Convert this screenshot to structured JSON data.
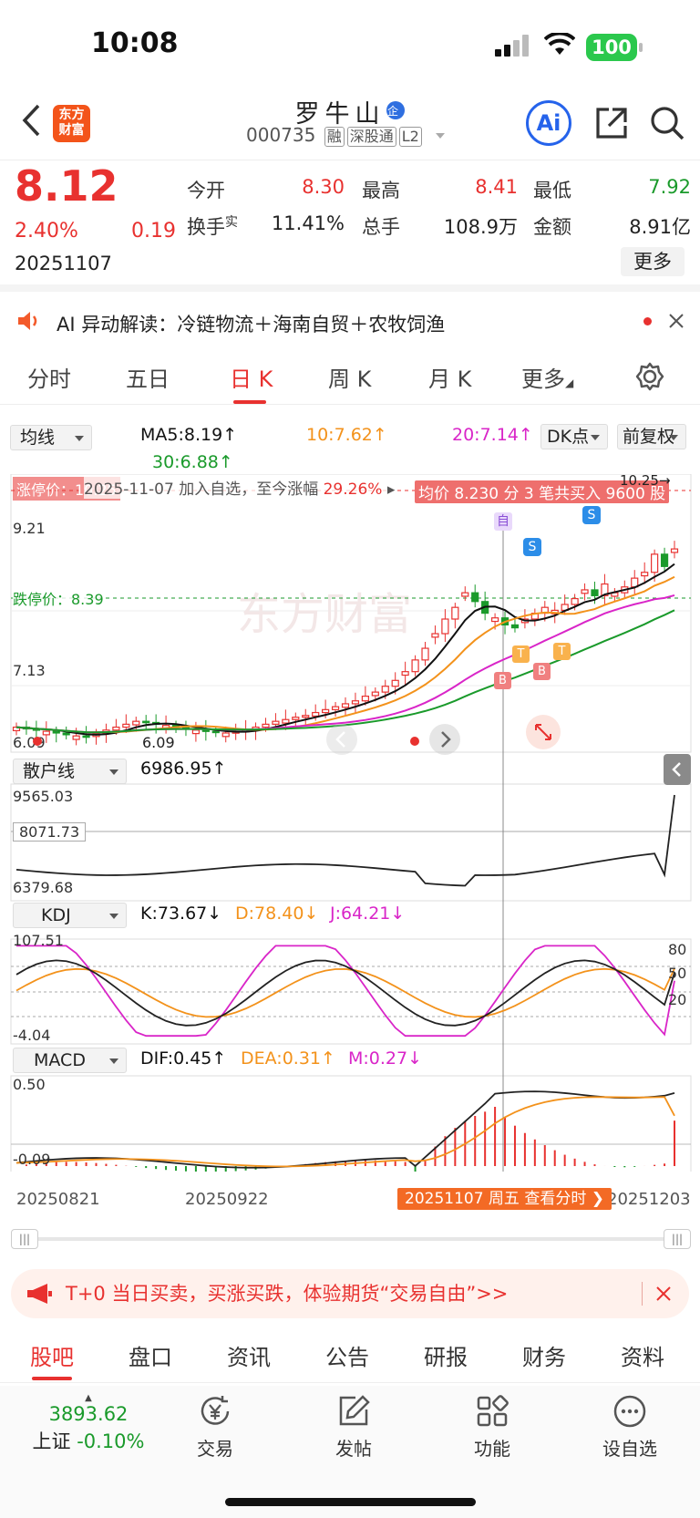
{
  "status": {
    "time": "10:08",
    "battery": "100"
  },
  "header": {
    "name": "罗牛山",
    "code": "000735",
    "tags": [
      "融",
      "深股通",
      "L2"
    ],
    "logo": "东方\n财富",
    "ai_label": "Ai"
  },
  "quote": {
    "price": "8.12",
    "change_pct": "2.40%",
    "change": "0.19",
    "date": "20251107",
    "open_label": "今开",
    "open": "8.30",
    "high_label": "最高",
    "high": "8.41",
    "low_label": "最低",
    "low": "7.92",
    "turnover_label": "换手",
    "turnover_sup": "实",
    "turnover": "11.41%",
    "volume_label": "总手",
    "volume": "108.9万",
    "amount_label": "金额",
    "amount": "8.91亿",
    "more": "更多"
  },
  "ai_bar": {
    "text": "AI 异动解读：冷链物流＋海南自贸＋农牧饲渔"
  },
  "period_tabs": [
    "分时",
    "五日",
    "日 K",
    "周 K",
    "月 K",
    "更多"
  ],
  "chart": {
    "ma_select": "均线",
    "ma5": "MA5:8.19",
    "ma10": "10:7.62",
    "ma20": "20:7.14",
    "ma30": "30:6.88",
    "dk_btn": "DK点",
    "fq_btn": "前复权",
    "limit_up": "涨停价：10.25",
    "since_note": "2025-11-07 加入自选，至今涨幅",
    "since_pct": "29.26%",
    "avg_note": "均价 8.230  分 3 笔共买入 9600 股",
    "top_mark": "10.25→",
    "y_high": "9.21",
    "y_mid": "7.13",
    "y_low": "6.09",
    "limit_down": "跌停价：8.39",
    "low_mark": "6.09",
    "watermark": "东方财富",
    "retail_select": "散户线",
    "retail_val": "6986.95",
    "retail_max": "9565.03",
    "retail_mid": "8071.73",
    "retail_min": "6379.68",
    "kdj_select": "KDJ",
    "k": "K:73.67",
    "d": "D:78.40",
    "j": "J:64.21",
    "kdj_max": "107.51",
    "kdj_min": "-4.04",
    "kdj_l80": "80",
    "kdj_l50": "50",
    "kdj_l20": "20",
    "macd_select": "MACD",
    "dif": "DIF:0.45",
    "dea": "DEA:0.31",
    "m": "M:0.27",
    "macd_max": "0.50",
    "macd_min": "-0.09",
    "x_dates": [
      "20250821",
      "20250922",
      "20251203"
    ],
    "cursor_label": "20251107 周五 查看分时",
    "marks": {
      "zi": "自",
      "s": "S",
      "b": "B",
      "t": "T"
    },
    "colors": {
      "up": "#e8312f",
      "down": "#1a9a2b",
      "ma5": "#111111",
      "ma10": "#f3921b",
      "ma20": "#d925c8",
      "ma30": "#1a9a2b"
    }
  },
  "chart_data": {
    "type": "candlestick",
    "closes_approx": [
      6.25,
      6.22,
      6.2,
      6.18,
      6.15,
      6.12,
      6.1,
      6.09,
      6.14,
      6.2,
      6.25,
      6.3,
      6.35,
      6.33,
      6.3,
      6.28,
      6.25,
      6.22,
      6.2,
      6.18,
      6.16,
      6.15,
      6.17,
      6.2,
      6.25,
      6.3,
      6.35,
      6.38,
      6.42,
      6.45,
      6.5,
      6.55,
      6.6,
      6.65,
      6.7,
      6.78,
      6.85,
      6.95,
      7.05,
      7.2,
      7.4,
      7.6,
      7.85,
      8.1,
      8.3,
      8.55,
      8.4,
      8.2,
      8.12,
      8.0,
      7.95,
      8.1,
      8.2,
      8.3,
      8.25,
      8.35,
      8.45,
      8.6,
      8.5,
      8.7,
      8.55,
      8.65,
      8.8,
      8.9,
      9.21,
      9.0,
      9.3
    ],
    "retail_line": {
      "max": 9565.03,
      "min": 6379.68,
      "last": 6986.95
    },
    "kdj": {
      "K": 73.67,
      "D": 78.4,
      "J": 64.21,
      "ylim": [
        -4.04,
        107.51
      ]
    },
    "macd": {
      "DIF": 0.45,
      "DEA": 0.31,
      "M": 0.27,
      "ylim": [
        -0.09,
        0.5
      ]
    }
  },
  "promo": {
    "text": "T+0 当日买卖，买涨买跌，体验期货“交易自由”>>"
  },
  "bottom_tabs": [
    "股吧",
    "盘口",
    "资讯",
    "公告",
    "研报",
    "财务",
    "资料"
  ],
  "dock": {
    "index_val": "3893.62",
    "index_name": "上证",
    "index_chg": "-0.10%",
    "trade": "交易",
    "post": "发帖",
    "func": "功能",
    "watch": "设自选"
  }
}
